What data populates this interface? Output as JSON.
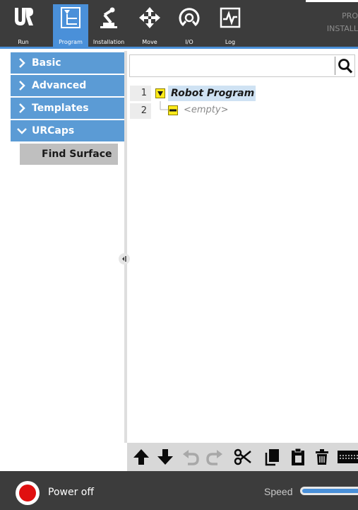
{
  "nav": {
    "tabs": [
      {
        "label": "Run",
        "icon": "ur-logo-icon",
        "active": false
      },
      {
        "label": "Program",
        "icon": "program-tree-icon",
        "active": true
      },
      {
        "label": "Installation",
        "icon": "robot-arm-icon",
        "active": false
      },
      {
        "label": "Move",
        "icon": "move-arrows-icon",
        "active": false
      },
      {
        "label": "I/O",
        "icon": "io-icon",
        "active": false
      },
      {
        "label": "Log",
        "icon": "log-graph-icon",
        "active": false
      }
    ],
    "program_label": "PRO",
    "installation_label": "INSTALL"
  },
  "sidebar": {
    "categories": [
      {
        "label": "Basic",
        "expanded": false
      },
      {
        "label": "Advanced",
        "expanded": false
      },
      {
        "label": "Templates",
        "expanded": false
      },
      {
        "label": "URCaps",
        "expanded": true
      }
    ],
    "urcaps_items": [
      {
        "label": "Find Surface",
        "selected": true
      }
    ]
  },
  "search": {
    "value": "",
    "placeholder": ""
  },
  "program_tree": {
    "lines": [
      {
        "number": "1",
        "label": "Robot Program",
        "icon": "collapse-triangle-icon"
      },
      {
        "number": "2",
        "label": "<empty>",
        "icon": "empty-node-icon"
      }
    ]
  },
  "edit_toolbar": {
    "buttons": [
      "move-up-icon",
      "move-down-icon",
      "undo-icon",
      "redo-icon",
      "cut-icon",
      "copy-icon",
      "paste-icon",
      "delete-icon",
      "suppress-icon"
    ]
  },
  "footer": {
    "power_label": "Power off",
    "speed_label": "Speed",
    "speed_fraction": 1.0
  },
  "colors": {
    "toolbar_bg": "#3c3c3c",
    "accent_blue": "#4a90d9",
    "category_blue": "#5b9bd5",
    "power_red": "#e01010",
    "node_yellow": "#ffeb1a"
  }
}
